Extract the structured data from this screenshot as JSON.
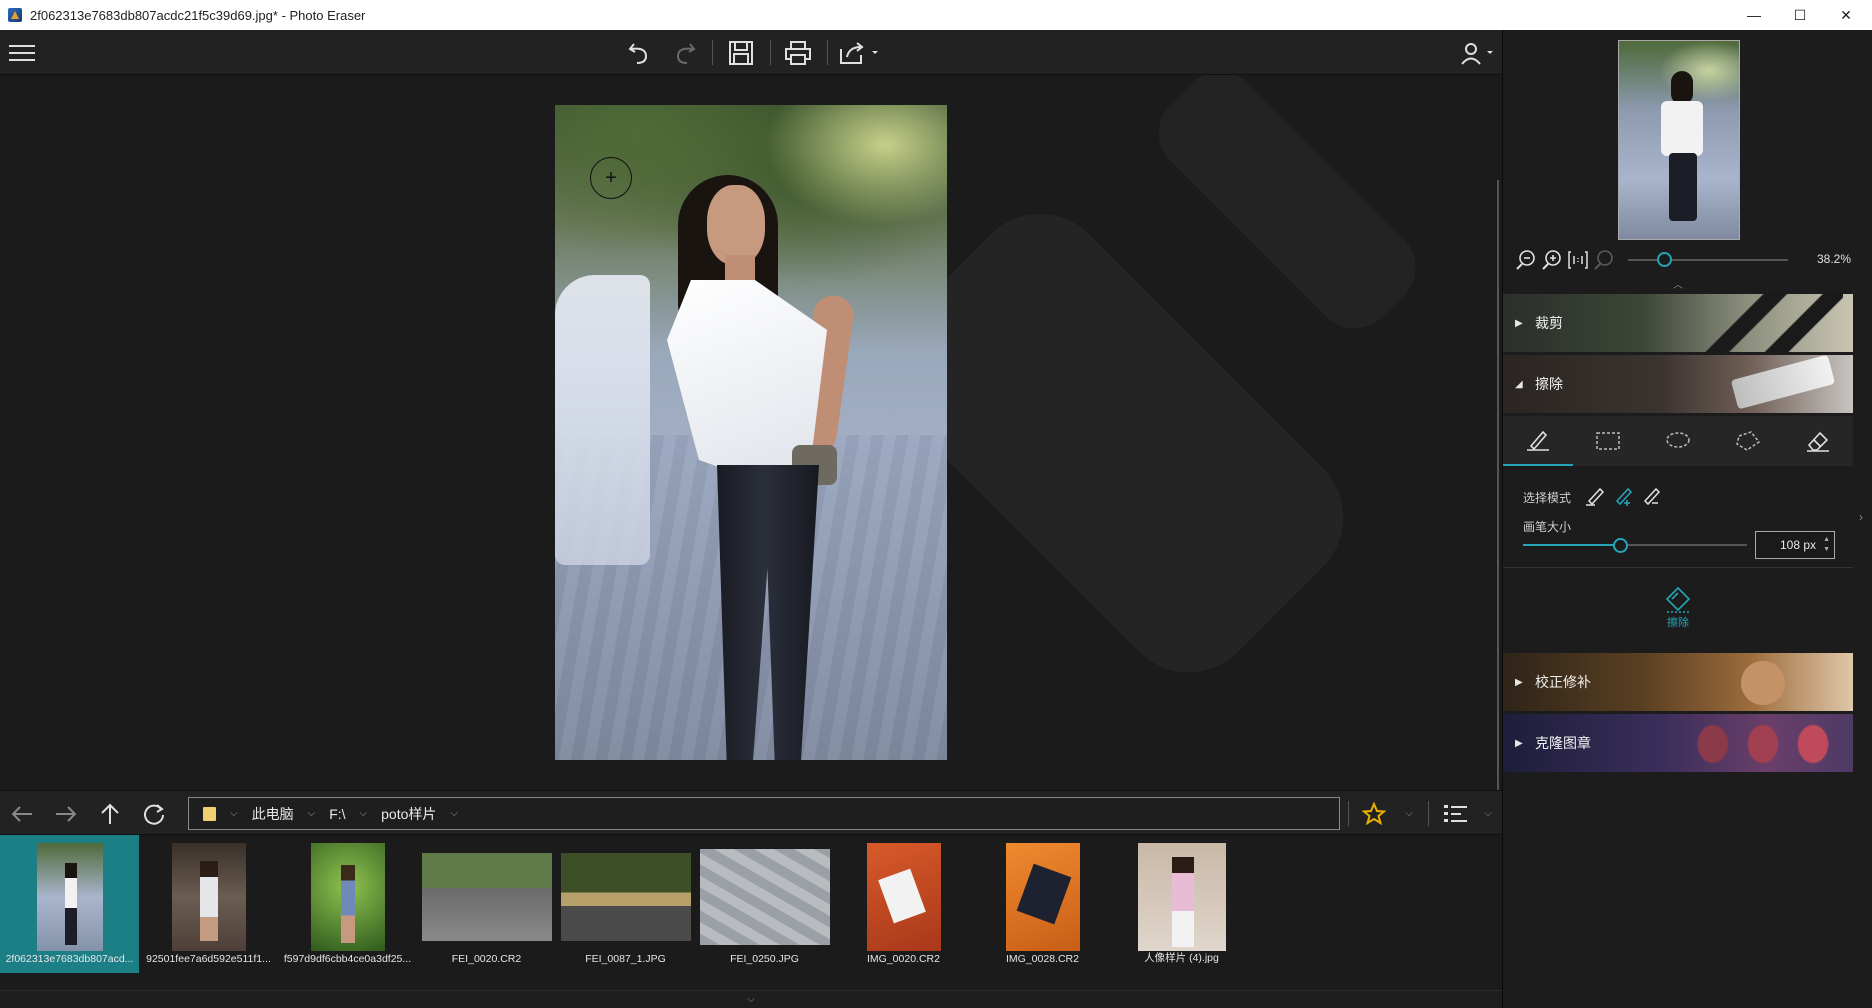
{
  "window": {
    "title": "2f062313e7683db807acdc21f5c39d69.jpg* - Photo Eraser",
    "minimize": "—",
    "maximize": "☐",
    "close": "✕"
  },
  "toolbar": {
    "menu_icon": "hamburger-icon",
    "undo_icon": "undo-icon",
    "redo_icon": "redo-icon",
    "save_icon": "save-icon",
    "print_icon": "print-icon",
    "share_icon": "share-icon",
    "user_icon": "user-icon"
  },
  "nav": {
    "crumbs": [
      {
        "label": "此电脑"
      },
      {
        "label": "F:\\"
      },
      {
        "label": "poto样片"
      }
    ]
  },
  "thumbnails": [
    {
      "name": "2f062313e7683db807acd...",
      "active": true
    },
    {
      "name": "92501fee7a6d592e511f1..."
    },
    {
      "name": "f597d9df6cbb4ce0a3df25..."
    },
    {
      "name": "FEI_0020.CR2"
    },
    {
      "name": "FEI_0087_1.JPG"
    },
    {
      "name": "FEI_0250.JPG"
    },
    {
      "name": "IMG_0020.CR2"
    },
    {
      "name": "IMG_0028.CR2"
    },
    {
      "name": "人像样片 (4).jpg"
    }
  ],
  "panel": {
    "zoom_value": "38.2%",
    "zoom_level": 0.3,
    "sections": {
      "crop": "裁剪",
      "erase": "擦除",
      "correct": "校正修补",
      "clone": "克隆图章"
    },
    "erase": {
      "select_mode_label": "选择模式",
      "brush_size_label": "画笔大小",
      "brush_size_value": "108 px",
      "action_label": "擦除"
    }
  },
  "colors": {
    "accent": "#24a5b8",
    "active_thumb": "#1d7f86",
    "star": "#e8b100"
  }
}
